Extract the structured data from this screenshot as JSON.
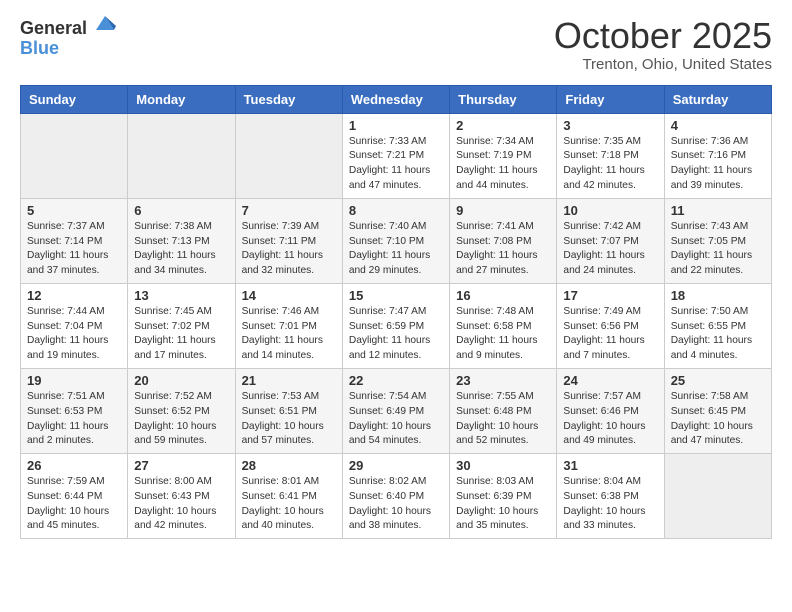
{
  "header": {
    "logo_general": "General",
    "logo_blue": "Blue",
    "month_title": "October 2025",
    "location": "Trenton, Ohio, United States"
  },
  "weekdays": [
    "Sunday",
    "Monday",
    "Tuesday",
    "Wednesday",
    "Thursday",
    "Friday",
    "Saturday"
  ],
  "weeks": [
    [
      {
        "day": "",
        "sunrise": "",
        "sunset": "",
        "daylight": "",
        "empty": true
      },
      {
        "day": "",
        "sunrise": "",
        "sunset": "",
        "daylight": "",
        "empty": true
      },
      {
        "day": "",
        "sunrise": "",
        "sunset": "",
        "daylight": "",
        "empty": true
      },
      {
        "day": "1",
        "sunrise": "Sunrise: 7:33 AM",
        "sunset": "Sunset: 7:21 PM",
        "daylight": "Daylight: 11 hours and 47 minutes."
      },
      {
        "day": "2",
        "sunrise": "Sunrise: 7:34 AM",
        "sunset": "Sunset: 7:19 PM",
        "daylight": "Daylight: 11 hours and 44 minutes."
      },
      {
        "day": "3",
        "sunrise": "Sunrise: 7:35 AM",
        "sunset": "Sunset: 7:18 PM",
        "daylight": "Daylight: 11 hours and 42 minutes."
      },
      {
        "day": "4",
        "sunrise": "Sunrise: 7:36 AM",
        "sunset": "Sunset: 7:16 PM",
        "daylight": "Daylight: 11 hours and 39 minutes."
      }
    ],
    [
      {
        "day": "5",
        "sunrise": "Sunrise: 7:37 AM",
        "sunset": "Sunset: 7:14 PM",
        "daylight": "Daylight: 11 hours and 37 minutes."
      },
      {
        "day": "6",
        "sunrise": "Sunrise: 7:38 AM",
        "sunset": "Sunset: 7:13 PM",
        "daylight": "Daylight: 11 hours and 34 minutes."
      },
      {
        "day": "7",
        "sunrise": "Sunrise: 7:39 AM",
        "sunset": "Sunset: 7:11 PM",
        "daylight": "Daylight: 11 hours and 32 minutes."
      },
      {
        "day": "8",
        "sunrise": "Sunrise: 7:40 AM",
        "sunset": "Sunset: 7:10 PM",
        "daylight": "Daylight: 11 hours and 29 minutes."
      },
      {
        "day": "9",
        "sunrise": "Sunrise: 7:41 AM",
        "sunset": "Sunset: 7:08 PM",
        "daylight": "Daylight: 11 hours and 27 minutes."
      },
      {
        "day": "10",
        "sunrise": "Sunrise: 7:42 AM",
        "sunset": "Sunset: 7:07 PM",
        "daylight": "Daylight: 11 hours and 24 minutes."
      },
      {
        "day": "11",
        "sunrise": "Sunrise: 7:43 AM",
        "sunset": "Sunset: 7:05 PM",
        "daylight": "Daylight: 11 hours and 22 minutes."
      }
    ],
    [
      {
        "day": "12",
        "sunrise": "Sunrise: 7:44 AM",
        "sunset": "Sunset: 7:04 PM",
        "daylight": "Daylight: 11 hours and 19 minutes."
      },
      {
        "day": "13",
        "sunrise": "Sunrise: 7:45 AM",
        "sunset": "Sunset: 7:02 PM",
        "daylight": "Daylight: 11 hours and 17 minutes."
      },
      {
        "day": "14",
        "sunrise": "Sunrise: 7:46 AM",
        "sunset": "Sunset: 7:01 PM",
        "daylight": "Daylight: 11 hours and 14 minutes."
      },
      {
        "day": "15",
        "sunrise": "Sunrise: 7:47 AM",
        "sunset": "Sunset: 6:59 PM",
        "daylight": "Daylight: 11 hours and 12 minutes."
      },
      {
        "day": "16",
        "sunrise": "Sunrise: 7:48 AM",
        "sunset": "Sunset: 6:58 PM",
        "daylight": "Daylight: 11 hours and 9 minutes."
      },
      {
        "day": "17",
        "sunrise": "Sunrise: 7:49 AM",
        "sunset": "Sunset: 6:56 PM",
        "daylight": "Daylight: 11 hours and 7 minutes."
      },
      {
        "day": "18",
        "sunrise": "Sunrise: 7:50 AM",
        "sunset": "Sunset: 6:55 PM",
        "daylight": "Daylight: 11 hours and 4 minutes."
      }
    ],
    [
      {
        "day": "19",
        "sunrise": "Sunrise: 7:51 AM",
        "sunset": "Sunset: 6:53 PM",
        "daylight": "Daylight: 11 hours and 2 minutes."
      },
      {
        "day": "20",
        "sunrise": "Sunrise: 7:52 AM",
        "sunset": "Sunset: 6:52 PM",
        "daylight": "Daylight: 10 hours and 59 minutes."
      },
      {
        "day": "21",
        "sunrise": "Sunrise: 7:53 AM",
        "sunset": "Sunset: 6:51 PM",
        "daylight": "Daylight: 10 hours and 57 minutes."
      },
      {
        "day": "22",
        "sunrise": "Sunrise: 7:54 AM",
        "sunset": "Sunset: 6:49 PM",
        "daylight": "Daylight: 10 hours and 54 minutes."
      },
      {
        "day": "23",
        "sunrise": "Sunrise: 7:55 AM",
        "sunset": "Sunset: 6:48 PM",
        "daylight": "Daylight: 10 hours and 52 minutes."
      },
      {
        "day": "24",
        "sunrise": "Sunrise: 7:57 AM",
        "sunset": "Sunset: 6:46 PM",
        "daylight": "Daylight: 10 hours and 49 minutes."
      },
      {
        "day": "25",
        "sunrise": "Sunrise: 7:58 AM",
        "sunset": "Sunset: 6:45 PM",
        "daylight": "Daylight: 10 hours and 47 minutes."
      }
    ],
    [
      {
        "day": "26",
        "sunrise": "Sunrise: 7:59 AM",
        "sunset": "Sunset: 6:44 PM",
        "daylight": "Daylight: 10 hours and 45 minutes."
      },
      {
        "day": "27",
        "sunrise": "Sunrise: 8:00 AM",
        "sunset": "Sunset: 6:43 PM",
        "daylight": "Daylight: 10 hours and 42 minutes."
      },
      {
        "day": "28",
        "sunrise": "Sunrise: 8:01 AM",
        "sunset": "Sunset: 6:41 PM",
        "daylight": "Daylight: 10 hours and 40 minutes."
      },
      {
        "day": "29",
        "sunrise": "Sunrise: 8:02 AM",
        "sunset": "Sunset: 6:40 PM",
        "daylight": "Daylight: 10 hours and 38 minutes."
      },
      {
        "day": "30",
        "sunrise": "Sunrise: 8:03 AM",
        "sunset": "Sunset: 6:39 PM",
        "daylight": "Daylight: 10 hours and 35 minutes."
      },
      {
        "day": "31",
        "sunrise": "Sunrise: 8:04 AM",
        "sunset": "Sunset: 6:38 PM",
        "daylight": "Daylight: 10 hours and 33 minutes."
      },
      {
        "day": "",
        "sunrise": "",
        "sunset": "",
        "daylight": "",
        "empty": true
      }
    ]
  ]
}
